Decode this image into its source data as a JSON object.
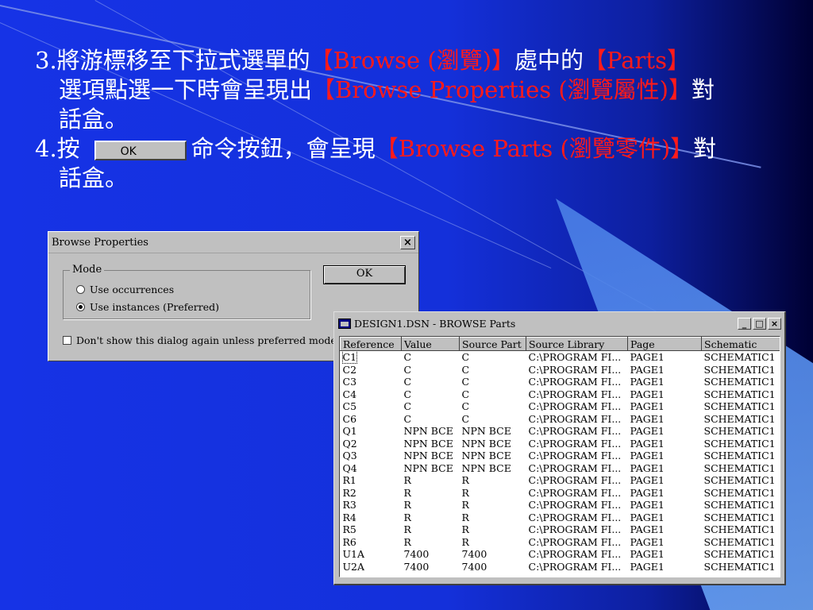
{
  "slide": {
    "item3": {
      "prefix": "3.將游標移至下拉式選單的",
      "menu": "【Browse (瀏覽)】",
      "mid": "處中的",
      "parts": "【Parts】",
      "line2a": "選項點選一下時會呈現出",
      "dlg": "【Browse Properties (瀏覽屬性)】",
      "suffix": "對",
      "line3": "話盒。"
    },
    "item4": {
      "prefix": "4.按",
      "button_label": "OK",
      "mid": "命令按鈕，會呈現",
      "dlg": "【Browse Parts (瀏覽零件)】",
      "suffix": "對",
      "line2": "話盒。"
    }
  },
  "browse_properties": {
    "title": "Browse Properties",
    "close_glyph": "×",
    "mode_legend": "Mode",
    "option1": "Use occurrences",
    "option2": "Use instances (Preferred)",
    "selected": "option2",
    "checkbox_label": "Don't show this dialog again unless preferred mode ch",
    "ok_label": "OK"
  },
  "browse_parts": {
    "title": "DESIGN1.DSN - BROWSE Parts",
    "controls": {
      "minimize": "_",
      "maximize": "□",
      "close": "×"
    },
    "columns": [
      "Reference",
      "Value",
      "Source Part",
      "Source Library",
      "Page",
      "Schematic"
    ],
    "rows": [
      [
        "C1",
        "C",
        "C",
        "C:\\PROGRAM FI...",
        "PAGE1",
        "SCHEMATIC1"
      ],
      [
        "C2",
        "C",
        "C",
        "C:\\PROGRAM FI...",
        "PAGE1",
        "SCHEMATIC1"
      ],
      [
        "C3",
        "C",
        "C",
        "C:\\PROGRAM FI...",
        "PAGE1",
        "SCHEMATIC1"
      ],
      [
        "C4",
        "C",
        "C",
        "C:\\PROGRAM FI...",
        "PAGE1",
        "SCHEMATIC1"
      ],
      [
        "C5",
        "C",
        "C",
        "C:\\PROGRAM FI...",
        "PAGE1",
        "SCHEMATIC1"
      ],
      [
        "C6",
        "C",
        "C",
        "C:\\PROGRAM FI...",
        "PAGE1",
        "SCHEMATIC1"
      ],
      [
        "Q1",
        "NPN BCE",
        "NPN BCE",
        "C:\\PROGRAM FI...",
        "PAGE1",
        "SCHEMATIC1"
      ],
      [
        "Q2",
        "NPN BCE",
        "NPN BCE",
        "C:\\PROGRAM FI...",
        "PAGE1",
        "SCHEMATIC1"
      ],
      [
        "Q3",
        "NPN BCE",
        "NPN BCE",
        "C:\\PROGRAM FI...",
        "PAGE1",
        "SCHEMATIC1"
      ],
      [
        "Q4",
        "NPN BCE",
        "NPN BCE",
        "C:\\PROGRAM FI...",
        "PAGE1",
        "SCHEMATIC1"
      ],
      [
        "R1",
        "R",
        "R",
        "C:\\PROGRAM FI...",
        "PAGE1",
        "SCHEMATIC1"
      ],
      [
        "R2",
        "R",
        "R",
        "C:\\PROGRAM FI...",
        "PAGE1",
        "SCHEMATIC1"
      ],
      [
        "R3",
        "R",
        "R",
        "C:\\PROGRAM FI...",
        "PAGE1",
        "SCHEMATIC1"
      ],
      [
        "R4",
        "R",
        "R",
        "C:\\PROGRAM FI...",
        "PAGE1",
        "SCHEMATIC1"
      ],
      [
        "R5",
        "R",
        "R",
        "C:\\PROGRAM FI...",
        "PAGE1",
        "SCHEMATIC1"
      ],
      [
        "R6",
        "R",
        "R",
        "C:\\PROGRAM FI...",
        "PAGE1",
        "SCHEMATIC1"
      ],
      [
        "U1A",
        "7400",
        "7400",
        "C:\\PROGRAM FI...",
        "PAGE1",
        "SCHEMATIC1"
      ],
      [
        "U2A",
        "7400",
        "7400",
        "C:\\PROGRAM FI...",
        "PAGE1",
        "SCHEMATIC1"
      ]
    ],
    "selected_row": 0
  },
  "colors": {
    "background": "#1633e6",
    "highlight_text": "#ff1a1a",
    "body_text": "#ffffff",
    "dialog_face": "#c0c0c0"
  }
}
